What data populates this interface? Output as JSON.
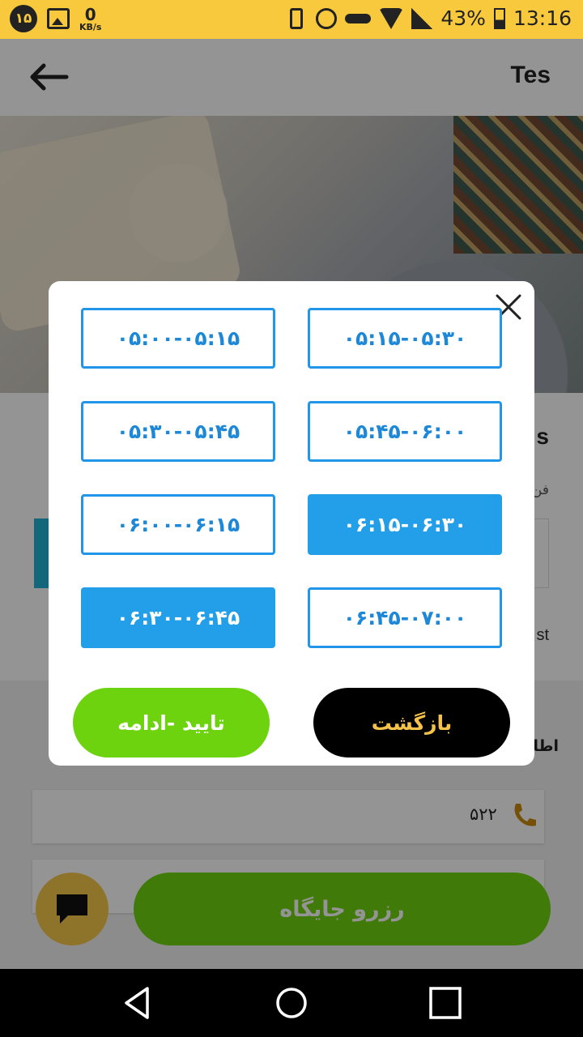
{
  "status_bar": {
    "badge": "۱۵",
    "net_speed_value": "0",
    "net_speed_unit": "KB/s",
    "battery": "43%",
    "time": "13:16",
    "icons": [
      "image-icon",
      "vibrate-icon",
      "alarm-icon",
      "vpn-key-icon",
      "wifi-icon",
      "signal-icon",
      "battery-icon"
    ]
  },
  "app_bar": {
    "title": "Tes",
    "back_icon": "arrow-left-icon"
  },
  "background": {
    "title_fragment": "s",
    "subtitle_fragment": "فن",
    "text_fragment": "st",
    "section_title_fragment": "اطلا",
    "phone_text": "۵۲۲",
    "reserve_button": "رزرو جایگاه"
  },
  "dialog": {
    "slots": [
      {
        "label": "۰۵:۰۰-۰۵:۱۵",
        "selected": false
      },
      {
        "label": "۰۵:۱۵-۰۵:۳۰",
        "selected": false
      },
      {
        "label": "۰۵:۳۰-۰۵:۴۵",
        "selected": false
      },
      {
        "label": "۰۵:۴۵-۰۶:۰۰",
        "selected": false
      },
      {
        "label": "۰۶:۰۰-۰۶:۱۵",
        "selected": false
      },
      {
        "label": "۰۶:۱۵-۰۶:۳۰",
        "selected": true
      },
      {
        "label": "۰۶:۳۰-۰۶:۴۵",
        "selected": true
      },
      {
        "label": "۰۶:۴۵-۰۷:۰۰",
        "selected": false
      }
    ],
    "confirm_label": "تایید -ادامه",
    "back_label": "بازگشت"
  },
  "colors": {
    "status_bar": "#f8c93c",
    "slot_border": "#2196e8",
    "slot_selected": "#239ee9",
    "confirm": "#6ed30f",
    "back_bg": "#000000",
    "back_text": "#f6c34a"
  }
}
